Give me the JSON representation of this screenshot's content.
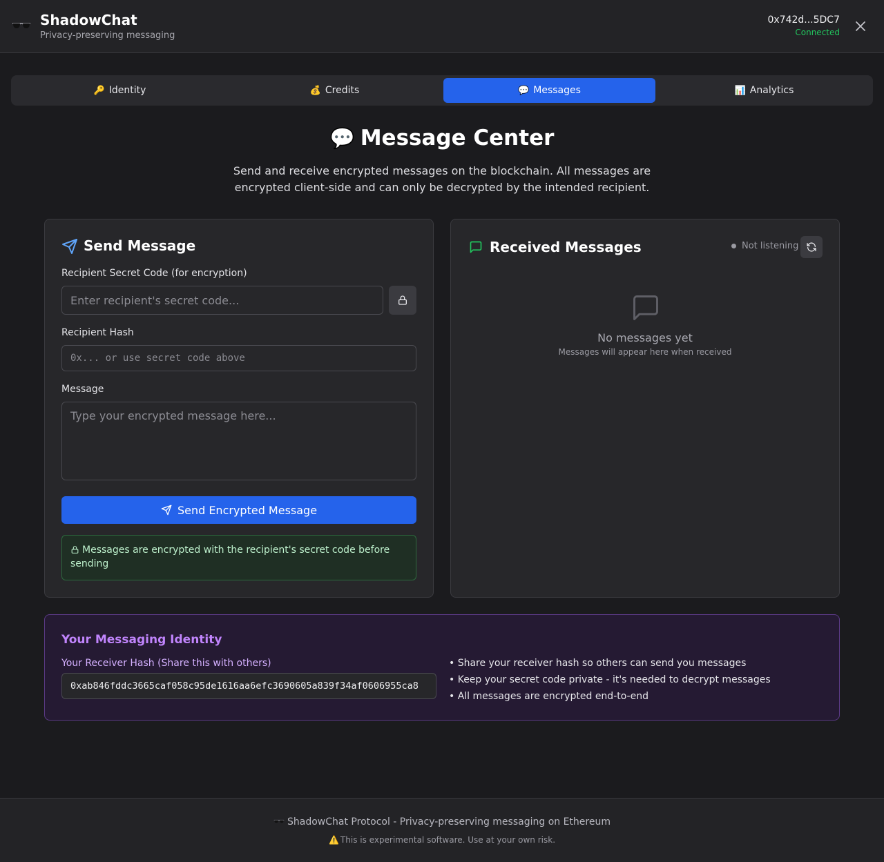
{
  "app": {
    "name": "ShadowChat",
    "tagline": "Privacy-preserving messaging",
    "logo_icon": "sunglasses-icon"
  },
  "wallet": {
    "address": "0x742d...5DC7",
    "status": "Connected",
    "status_color": "#22c55e"
  },
  "tabs": [
    {
      "label": "Identity",
      "icon": "key-icon",
      "glyph": "🔑",
      "active": false
    },
    {
      "label": "Credits",
      "icon": "money-bag-icon",
      "glyph": "💰",
      "active": false
    },
    {
      "label": "Messages",
      "icon": "speech-bubble-icon",
      "glyph": "💬",
      "active": true
    },
    {
      "label": "Analytics",
      "icon": "bar-chart-icon",
      "glyph": "📊",
      "active": false
    }
  ],
  "page": {
    "title_glyph": "💬",
    "title": "Message Center",
    "description": "Send and receive encrypted messages on the blockchain. All messages are encrypted client-side and can only be decrypted by the intended recipient."
  },
  "send": {
    "heading": "Send Message",
    "secret_label": "Recipient Secret Code (for encryption)",
    "secret_placeholder": "Enter recipient's secret code...",
    "hash_label": "Recipient Hash",
    "hash_placeholder": "0x... or use secret code above",
    "message_label": "Message",
    "message_placeholder": "Type your encrypted message here...",
    "button_label": "Send Encrypted Message",
    "notice": "Messages are encrypted with the recipient's secret code before sending"
  },
  "received": {
    "heading": "Received Messages",
    "status": "Not listening",
    "empty_title": "No messages yet",
    "empty_sub": "Messages will appear here when received"
  },
  "identity": {
    "title": "Your Messaging Identity",
    "hash_label": "Your Receiver Hash (Share this with others)",
    "hash_value": "0xab846fddc3665caf058c95de1616aa6efc3690605a839f34af0606955ca8",
    "tips": [
      "• Share your receiver hash so others can send you messages",
      "• Keep your secret code private - it's needed to decrypt messages",
      "• All messages are encrypted end-to-end"
    ]
  },
  "footer": {
    "line1": "ShadowChat Protocol - Privacy-preserving messaging on Ethereum",
    "line2": "This is experimental software. Use at your own risk."
  },
  "colors": {
    "accent": "#2563eb",
    "success": "#22c55e",
    "identity_accent": "#c084fc",
    "send_icon": "#60a5fa",
    "received_icon": "#22c55e"
  }
}
